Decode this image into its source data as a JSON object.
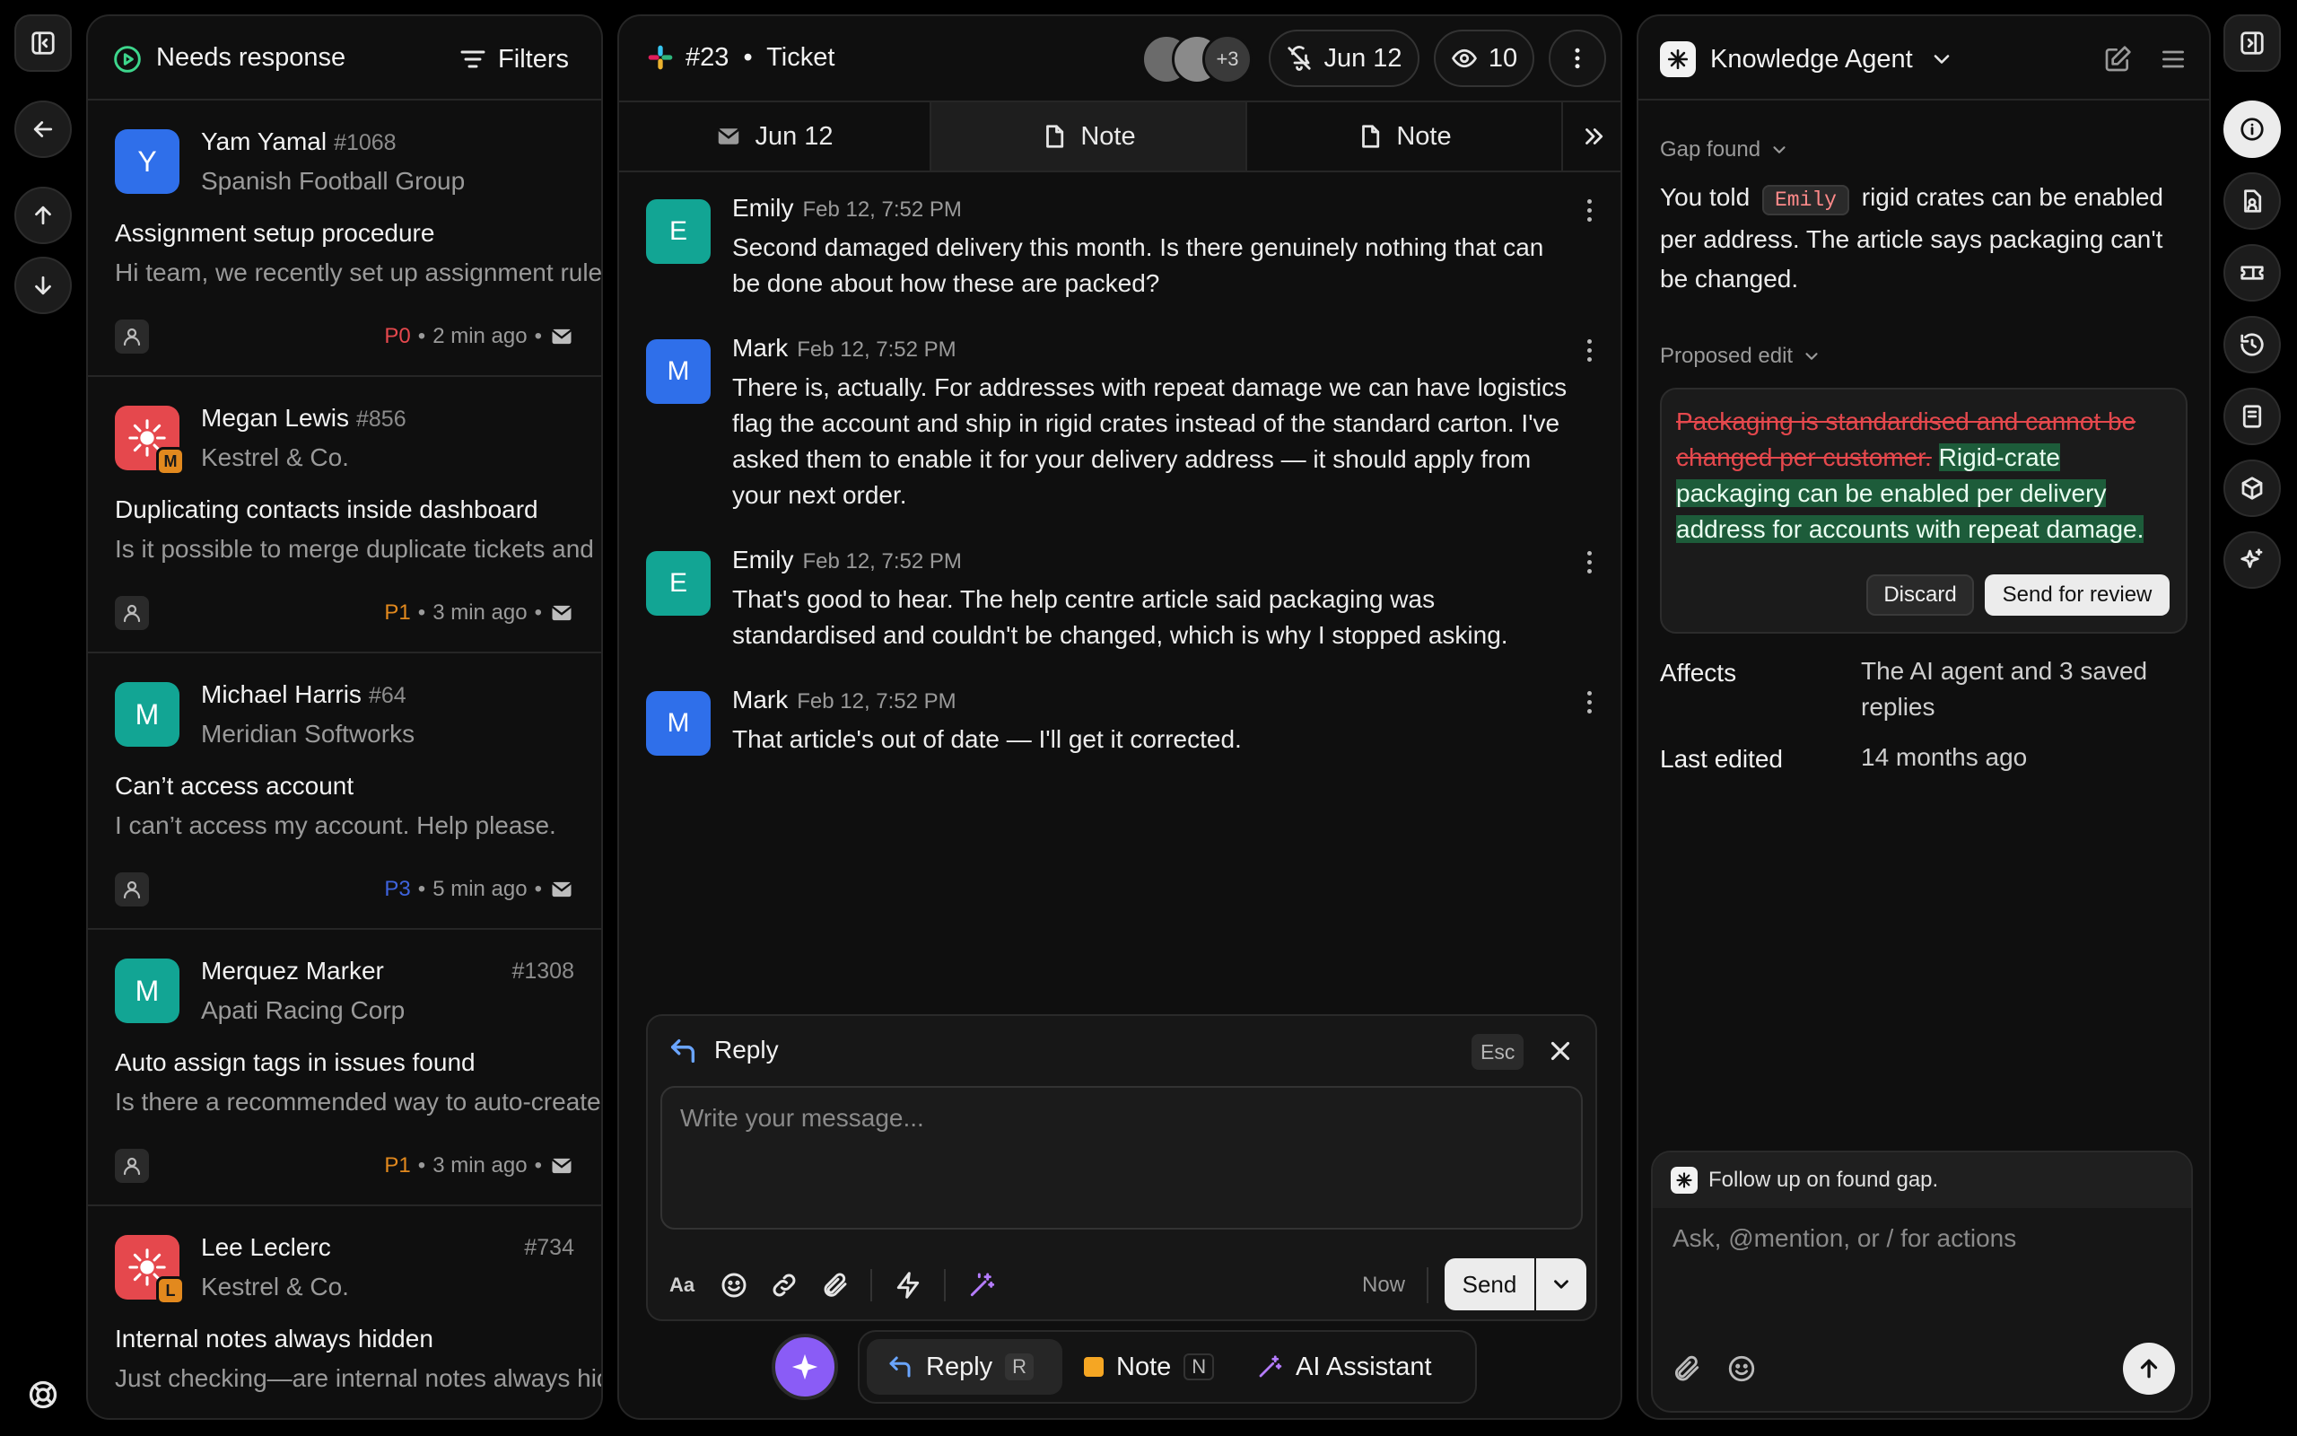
{
  "list": {
    "title": "Needs response",
    "filters_label": "Filters",
    "tickets": [
      {
        "avatar_letter": "Y",
        "avatar_color": "#2f6fea",
        "name": "Yam Yamal",
        "id": "#1068",
        "id_right": false,
        "company": "Spanish Football Group",
        "subject": "Assignment setup procedure",
        "preview": "Hi team, we recently set up assignment rules",
        "priority": "P0",
        "priority_color": "#e5484d",
        "time": "2 min ago"
      },
      {
        "avatar_letter": "",
        "avatar_color": "#e5484d",
        "badge": "M",
        "name": "Megan Lewis",
        "id": "#856",
        "id_right": false,
        "company": "Kestrel & Co.",
        "subject": "Duplicating contacts inside dashboard",
        "preview": "Is it possible to merge duplicate tickets and contacts",
        "priority": "P1",
        "priority_color": "#e2891e",
        "time": "3 min ago"
      },
      {
        "avatar_letter": "M",
        "avatar_color": "#12a594",
        "name": "Michael Harris",
        "id": "#64",
        "id_right": false,
        "company": "Meridian Softworks",
        "subject": "Can’t access account",
        "preview": "I can’t access my account. Help please.",
        "priority": "P3",
        "priority_color": "#3e63dd",
        "time": "5 min ago"
      },
      {
        "avatar_letter": "M",
        "avatar_color": "#12a594",
        "name": "Merquez Marker",
        "id": "#1308",
        "id_right": true,
        "company": "Apati Racing Corp",
        "subject": "Auto assign tags in issues found",
        "preview": "Is there a recommended way to auto-create tags",
        "priority": "P1",
        "priority_color": "#e2891e",
        "time": "3 min ago"
      },
      {
        "avatar_letter": "",
        "avatar_color": "#e5484d",
        "badge": "L",
        "name": "Lee Leclerc",
        "id": "#734",
        "id_right": true,
        "company": "Kestrel & Co.",
        "subject": "Internal notes always hidden",
        "preview": "Just checking—are internal notes always hidden",
        "priority": "",
        "priority_color": "",
        "time": ""
      }
    ]
  },
  "ticket": {
    "number": "#23",
    "separator": "•",
    "label": "Ticket",
    "extra_watchers": "+3",
    "snooze_date": "Jun 12",
    "views": "10",
    "tabs": [
      {
        "label": "Jun 12",
        "icon": "mail-icon"
      },
      {
        "label": "Note",
        "icon": "note-icon"
      },
      {
        "label": "Note",
        "icon": "note-icon"
      }
    ],
    "messages": [
      {
        "author": "Emily",
        "initial": "E",
        "color": "#12a594",
        "time": "Feb 12, 7:52 PM",
        "lines": [
          "Second damaged delivery this month. Is there genuinely nothing that can",
          "be done about how these are packed?"
        ]
      },
      {
        "author": "Mark",
        "initial": "M",
        "color": "#2f6fea",
        "time": "Feb 12, 7:52 PM",
        "lines": [
          "There is, actually. For addresses with repeat damage we can have logistics",
          "flag the account and ship in rigid crates instead of the standard carton. I've",
          "asked them to enable it for your delivery address — it should apply from",
          "your next order."
        ]
      },
      {
        "author": "Emily",
        "initial": "E",
        "color": "#12a594",
        "time": "Feb 12, 7:52 PM",
        "lines": [
          "That's good to hear. The help centre article said packaging was",
          "standardised and couldn't be changed, which is why I stopped asking."
        ]
      },
      {
        "author": "Mark",
        "initial": "M",
        "color": "#2f6fea",
        "time": "Feb 12, 7:52 PM",
        "lines": [
          "That article's out of date — I'll get it corrected."
        ]
      }
    ],
    "composer": {
      "mode": "Reply",
      "esc": "Esc",
      "placeholder": "Write your message...",
      "schedule": "Now",
      "send": "Send"
    },
    "bottom_bar": {
      "reply": "Reply",
      "reply_key": "R",
      "note": "Note",
      "note_key": "N",
      "ai": "AI Assistant"
    }
  },
  "agent": {
    "title": "Knowledge Agent",
    "gap_label": "Gap found",
    "gap_text_a": "You told",
    "gap_mention": "Emily",
    "gap_text_b": "rigid crates can be enabled",
    "gap_line2": "per address. The article says packaging can't",
    "gap_line3": "be changed.",
    "proposed_label": "Proposed edit",
    "removed_lines": [
      "Packaging is standardised and cannot be",
      "changed per customer."
    ],
    "added_first": "Rigid-crate",
    "added_lines": [
      "packaging can be enabled per delivery",
      "address for accounts with repeat damage."
    ],
    "discard": "Discard",
    "send_review": "Send for review",
    "affects_label": "Affects",
    "affects_value": "The AI agent and 3 saved replies",
    "edited_label": "Last edited",
    "edited_value": "14 months ago",
    "followup": "Follow up on found gap.",
    "ask_placeholder": "Ask, @mention, or / for actions"
  }
}
